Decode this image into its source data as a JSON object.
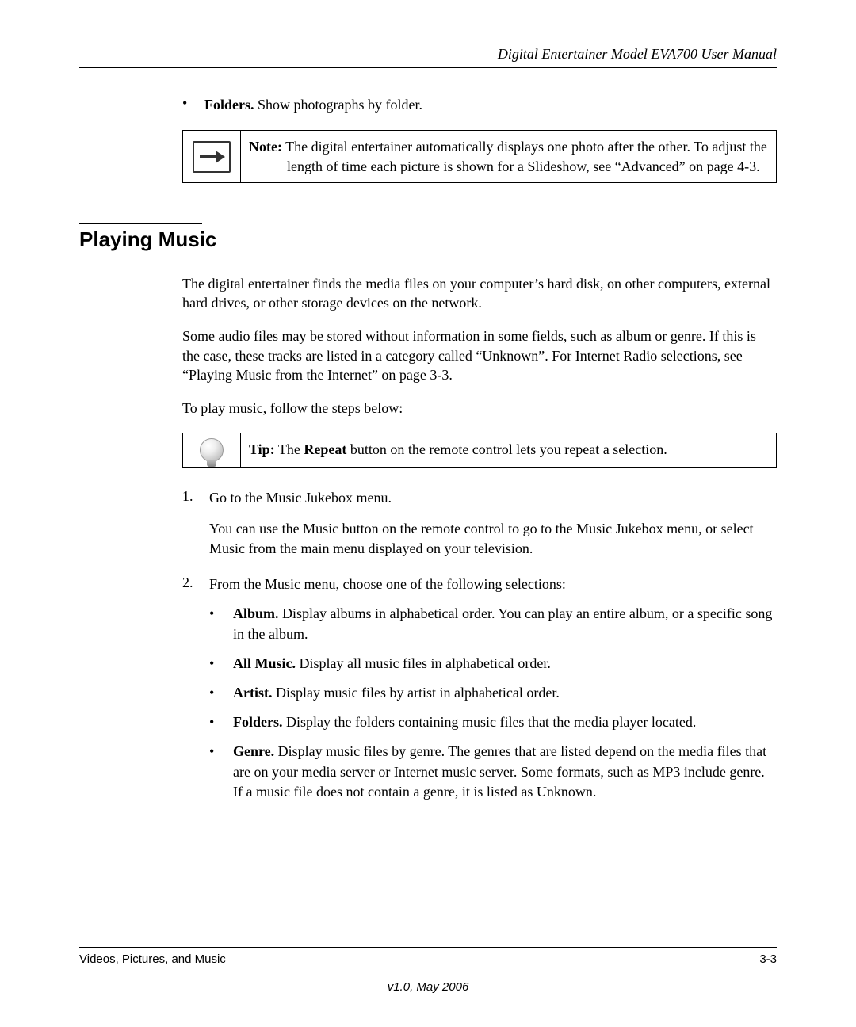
{
  "header": {
    "running_head": "Digital Entertainer Model EVA700 User Manual"
  },
  "top_bullet": {
    "label": "Folders.",
    "text": " Show photographs by folder."
  },
  "note_callout": {
    "label": "Note:",
    "text": " The digital entertainer automatically displays one photo after the other. To adjust the length of time each picture is shown for a Slideshow, see “Advanced” on page 4-3.",
    "icon": "arrow-right-icon"
  },
  "section": {
    "title": "Playing Music",
    "para1": "The digital entertainer finds the media files on your computer’s hard disk, on other computers, external hard drives, or other storage devices on the network.",
    "para2": "Some audio files may be stored without information in some fields, such as album or genre. If this is the case, these tracks are listed in a category called “Unknown”. For Internet Radio selections, see “Playing Music from the Internet” on page 3-3.",
    "para3": "To play music, follow the steps below:"
  },
  "tip_callout": {
    "label": "Tip:",
    "pre": " The ",
    "bold": "Repeat",
    "post": " button on the remote control lets you repeat a selection.",
    "icon": "lightbulb-icon"
  },
  "steps": {
    "s1_num": "1.",
    "s1_text": "Go to the Music Jukebox menu.",
    "s1_sub": "You can use the Music button on the remote control to go to the Music Jukebox menu, or select Music from the main menu displayed on your television.",
    "s2_num": "2.",
    "s2_text": "From the Music menu, choose one of the following selections:",
    "sub": [
      {
        "label": "Album.",
        "text": " Display albums in alphabetical order. You can play an entire album, or a specific song in the album."
      },
      {
        "label": "All Music.",
        "text": " Display all music files in alphabetical order."
      },
      {
        "label": "Artist.",
        "text": " Display music files by artist in alphabetical order."
      },
      {
        "label": "Folders.",
        "text": " Display the folders containing music files that the media player located."
      },
      {
        "label": "Genre.",
        "text": " Display music files by genre. The genres that are listed depend on the media files that are on your media server or Internet music server. Some formats, such as MP3 include genre. If a music file does not contain a genre, it is listed as Unknown."
      }
    ]
  },
  "footer": {
    "left": "Videos, Pictures, and Music",
    "right": "3-3",
    "version": "v1.0, May 2006"
  }
}
